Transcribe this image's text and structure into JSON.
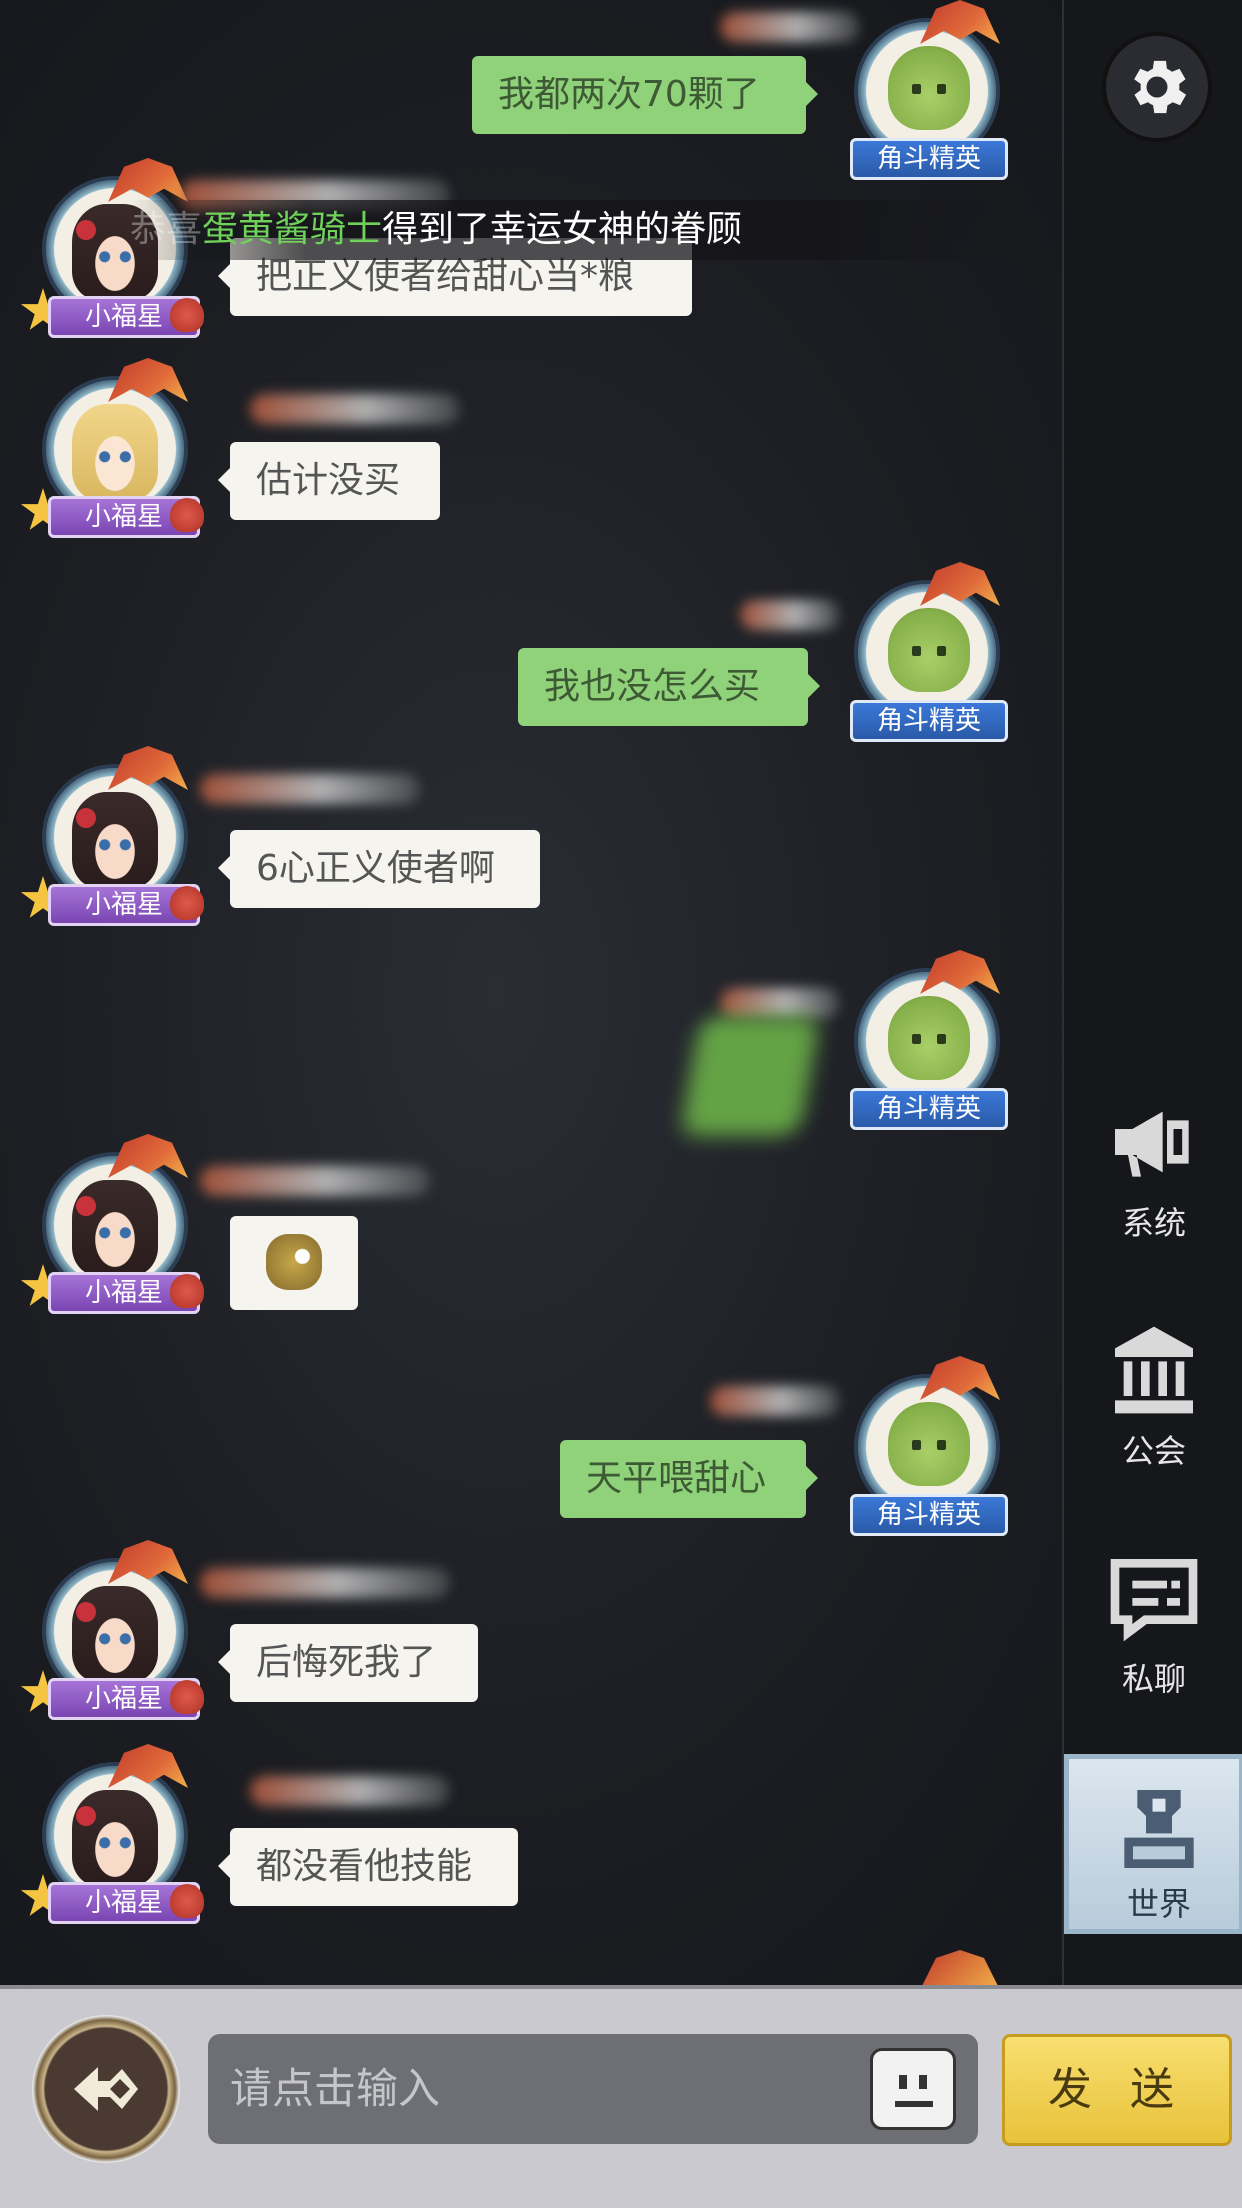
{
  "system_banner": {
    "prefix": "恭喜",
    "player": "蛋黄酱骑士",
    "suffix": "得到了幸运女神的眷顾"
  },
  "messages": [
    {
      "side": "right",
      "badge": "角斗精英",
      "text": "我都两次70颗了"
    },
    {
      "side": "left",
      "badge": "小福星",
      "text": "把正义使者给甜心当*粮"
    },
    {
      "side": "left",
      "badge": "小福星",
      "text": "估计没买"
    },
    {
      "side": "right",
      "badge": "角斗精英",
      "text": "我也没怎么买"
    },
    {
      "side": "left",
      "badge": "小福星",
      "text": "6心正义使者啊"
    },
    {
      "side": "right",
      "badge": "角斗精英",
      "text": ""
    },
    {
      "side": "left",
      "badge": "小福星",
      "text": ""
    },
    {
      "side": "right",
      "badge": "角斗精英",
      "text": "天平喂甜心"
    },
    {
      "side": "left",
      "badge": "小福星",
      "text": "后悔死我了"
    },
    {
      "side": "left",
      "badge": "小福星",
      "text": "都没看他技能"
    }
  ],
  "sidebar": {
    "items": [
      {
        "label": "系统",
        "icon": "megaphone-icon"
      },
      {
        "label": "公会",
        "icon": "guild-hall-icon"
      },
      {
        "label": "私聊",
        "icon": "chat-bubble-icon"
      },
      {
        "label": "世界",
        "icon": "world-tower-icon",
        "active": true
      }
    ]
  },
  "input": {
    "placeholder": "请点击输入"
  },
  "send_label": "发 送",
  "colors": {
    "right_bubble": "#8fd27a",
    "left_bubble": "#f6f4ee",
    "send_button": "#f0cf50",
    "left_badge": "#8a55c4",
    "right_badge": "#3068c0"
  }
}
